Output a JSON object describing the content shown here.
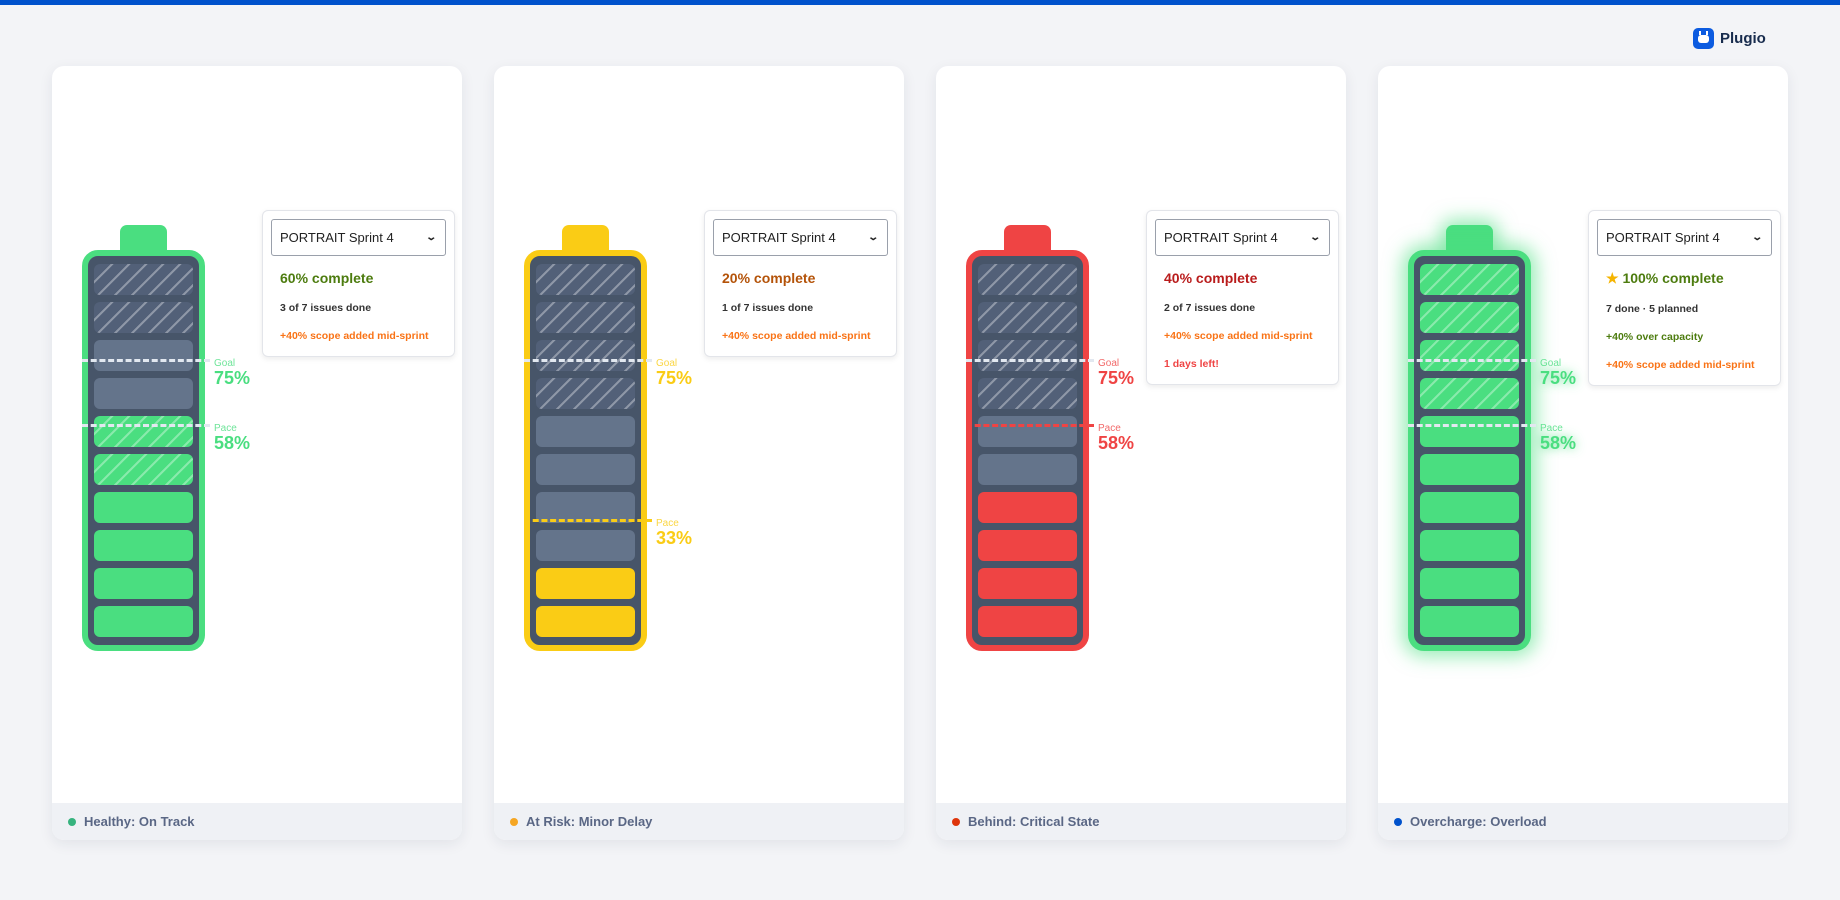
{
  "brand": {
    "name": "Plugio",
    "icon": "plug-icon"
  },
  "cards": [
    {
      "color": "#4ade80",
      "dot": "#36b37e",
      "status": "Healthy: On Track",
      "segments": [
        "planned",
        "planned",
        "empty",
        "empty",
        "hatch",
        "hatch",
        "fill",
        "fill",
        "fill",
        "fill"
      ],
      "goal": {
        "label": "Goal",
        "value": "75%",
        "fraction": 0.75,
        "line": "#e2e8f0"
      },
      "pace": {
        "label": "Pace",
        "value": "58%",
        "fraction": 0.58,
        "line": "#e2e8f0"
      },
      "popup": {
        "select": "PORTRAIT Sprint 4",
        "title": "60% complete",
        "title_color": "#4d7c0f",
        "lines": [
          {
            "text": "3 of 7 issues done",
            "color": "#333333"
          },
          {
            "text": "+40% scope added mid-sprint",
            "color": "#f97316"
          }
        ]
      }
    },
    {
      "color": "#facc15",
      "dot": "#f5a623",
      "status": "At Risk: Minor Delay",
      "segments": [
        "planned",
        "planned",
        "planned",
        "planned",
        "empty",
        "empty",
        "empty",
        "empty",
        "fill",
        "fill"
      ],
      "goal": {
        "label": "Goal",
        "value": "75%",
        "fraction": 0.75,
        "line": "#e2e8f0"
      },
      "pace": {
        "label": "Pace",
        "value": "33%",
        "fraction": 0.33,
        "line": "#facc15"
      },
      "popup": {
        "select": "PORTRAIT Sprint 4",
        "title": "20% complete",
        "title_color": "#b45309",
        "lines": [
          {
            "text": "1 of 7 issues done",
            "color": "#333333"
          },
          {
            "text": "+40% scope added mid-sprint",
            "color": "#f97316"
          }
        ]
      }
    },
    {
      "color": "#ef4444",
      "dot": "#de350b",
      "status": "Behind: Critical State",
      "segments": [
        "planned",
        "planned",
        "planned",
        "planned",
        "empty",
        "empty",
        "fill",
        "fill",
        "fill",
        "fill"
      ],
      "goal": {
        "label": "Goal",
        "value": "75%",
        "fraction": 0.75,
        "line": "#e2e8f0"
      },
      "pace": {
        "label": "Pace",
        "value": "58%",
        "fraction": 0.58,
        "line": "#ef4444"
      },
      "popup": {
        "select": "PORTRAIT Sprint 4",
        "title": "40% complete",
        "title_color": "#b91c1c",
        "lines": [
          {
            "text": "2 of 7 issues done",
            "color": "#333333"
          },
          {
            "text": "+40% scope added mid-sprint",
            "color": "#f97316"
          },
          {
            "text": "1 days left!",
            "color": "#ef4444"
          }
        ]
      }
    },
    {
      "color": "#4ade80",
      "dot": "#0052cc",
      "status": "Overcharge: Overload",
      "glow": true,
      "segments": [
        "hatch",
        "hatch",
        "hatch",
        "hatch",
        "fill",
        "fill",
        "fill",
        "fill",
        "fill",
        "fill"
      ],
      "goal": {
        "label": "Goal",
        "value": "75%",
        "fraction": 0.75,
        "line": "#e2e8f0"
      },
      "pace": {
        "label": "Pace",
        "value": "58%",
        "fraction": 0.58,
        "line": "#e2e8f0"
      },
      "popup": {
        "select": "PORTRAIT Sprint 4",
        "star": "★",
        "title": "100% complete",
        "title_color": "#4d7c0f",
        "lines": [
          {
            "text": "7 done · 5 planned",
            "color": "#333333"
          },
          {
            "text": "+40% over capacity",
            "color": "#4d7c0f"
          },
          {
            "text": "+40% scope added mid-sprint",
            "color": "#f97316"
          }
        ]
      }
    }
  ]
}
